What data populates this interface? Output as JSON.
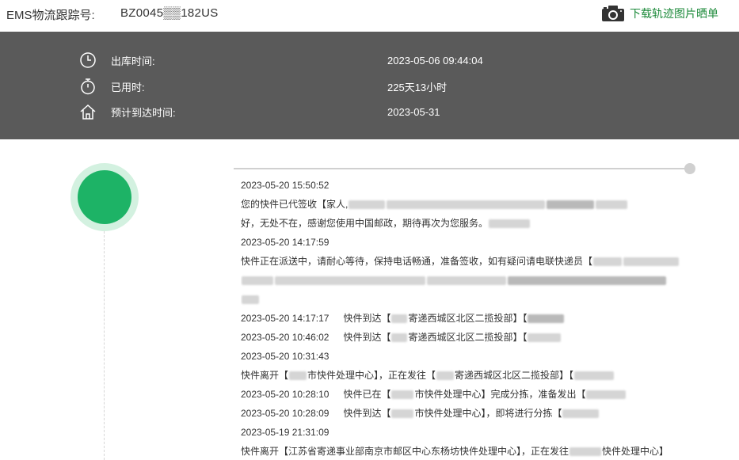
{
  "header": {
    "tracking_label": "EMS物流跟踪号:",
    "tracking_number": "BZ0045▒▒182US",
    "download_label": "下载轨迹图片晒单",
    "download_icon": "camera-icon",
    "accent_color": "#1c8a3a"
  },
  "info": {
    "ship_time_label": "出库时间:",
    "ship_time_value": "2023-05-06 09:44:04",
    "elapsed_label": "已用时:",
    "elapsed_value": "225天13小时",
    "eta_label": "预计到达时间:",
    "eta_value": "2023-05-31"
  },
  "events": [
    {
      "time": "2023-05-20 15:50:52"
    },
    {
      "desc1": "您的快件已代签收【家人,",
      "desc2": "好，无处不在，感谢您使用中国邮政，期待再次为您服务。"
    },
    {
      "time": "2023-05-20 14:17:59"
    },
    {
      "desc": "快件正在派送中，请耐心等待，保持电话畅通，准备签收，如有疑问请电联快递员【"
    },
    {
      "time": "2023-05-20 14:17:17",
      "desc": "快件到达【",
      "desc_b": "寄递西城区北区二揽投部】【"
    },
    {
      "time": "2023-05-20 10:46:02",
      "desc": "快件到达【",
      "desc_b": "寄递西城区北区二揽投部】【"
    },
    {
      "time": "2023-05-20 10:31:43"
    },
    {
      "desc": "快件离开【",
      "desc_b": "市快件处理中心】，正在发往【",
      "desc_c": "寄递西城区北区二揽投部】【"
    },
    {
      "time": "2023-05-20 10:28:10",
      "desc": "快件已在【",
      "desc_b": "市快件处理中心】完成分拣，准备发出【"
    },
    {
      "time": "2023-05-20 10:28:09",
      "desc": "快件到达【",
      "desc_b": "市快件处理中心】，即将进行分拣【"
    },
    {
      "time": "2023-05-19 21:31:09"
    },
    {
      "desc": "快件离开【江苏省寄递事业部南京市邮区中心东杨坊快件处理中心】，正在发往",
      "desc_b": "快件处理中心】"
    }
  ]
}
